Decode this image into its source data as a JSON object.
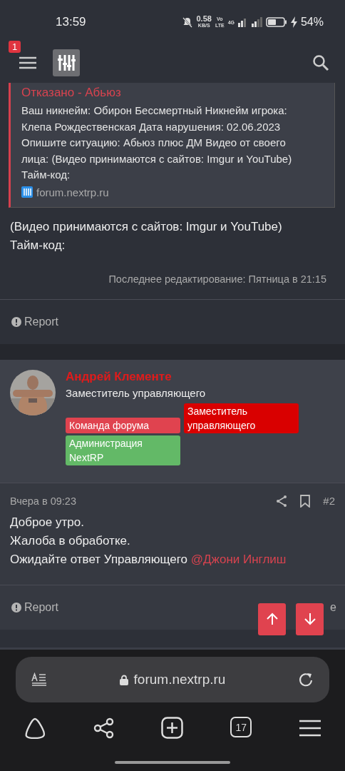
{
  "status_bar": {
    "time": "13:59",
    "net_speed": "0.58",
    "net_unit": "KB/S",
    "volte_top": "Vo",
    "volte_bottom": "LTE",
    "network": "4G",
    "battery": "54%"
  },
  "header": {
    "notification_count": "1"
  },
  "quote": {
    "title": "Отказано - Абьюз",
    "text": "Ваш никнейм: Обирон Бессмертный Никнейм игрока: Клепа Рождественская Дата нарушения: 02.06.2023 Опишите ситуацию: Абьюз плюс ДМ Видео от своего лица: (Видео принимаются с сайтов: Imgur и YouTube) Тайм-код:",
    "source": "forum.nextrp.ru"
  },
  "post1": {
    "lines": [
      "(Видео принимаются с сайтов: Imgur и YouTube)",
      "Тайм-код:"
    ],
    "edited": "Последнее редактирование: Пятница в 21:15",
    "report": "Report"
  },
  "post2": {
    "author": "Андрей Клементе",
    "user_title": "Заместитель управляющего",
    "banners": [
      {
        "label": "Команда форума",
        "color": "#e0434f"
      },
      {
        "label": "Заместитель управляющего",
        "color": "#d90000"
      },
      {
        "label": "Администрация NextRP",
        "color": "#63b967"
      }
    ],
    "date": "Вчера в 09:23",
    "number": "#2",
    "lines": [
      "Доброе утро.",
      "Жалоба в обработке."
    ],
    "last_line": "Ожидайте ответ Управляющего",
    "mention": "@Джони Инглиш",
    "report": "Report",
    "like_visible": "e"
  },
  "browser": {
    "url": "forum.nextrp.ru",
    "tabs_count": "17"
  }
}
